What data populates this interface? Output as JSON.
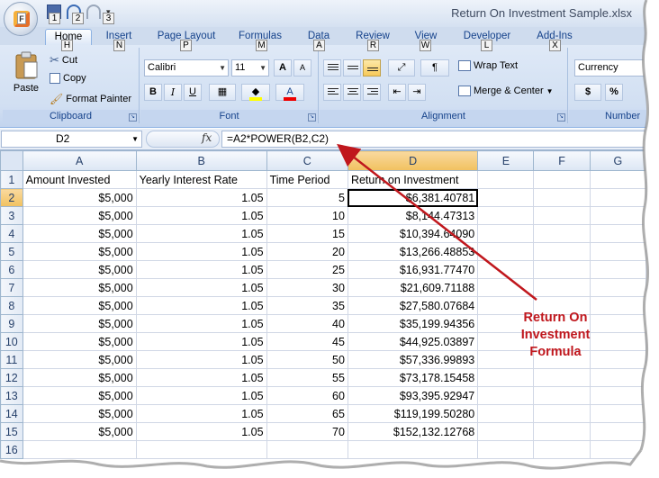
{
  "window": {
    "title": "Return On Investment Sample.xlsx"
  },
  "quick_access": {
    "office_logo": "F",
    "keytips": [
      "1",
      "2",
      "3"
    ]
  },
  "tabs": [
    {
      "label": "Home",
      "keytip": "H",
      "active": true
    },
    {
      "label": "Insert",
      "keytip": "N"
    },
    {
      "label": "Page Layout",
      "keytip": "P"
    },
    {
      "label": "Formulas",
      "keytip": "M"
    },
    {
      "label": "Data",
      "keytip": "A"
    },
    {
      "label": "Review",
      "keytip": "R"
    },
    {
      "label": "View",
      "keytip": "W"
    },
    {
      "label": "Developer",
      "keytip": "L"
    },
    {
      "label": "Add-Ins",
      "keytip": "X"
    }
  ],
  "ribbon": {
    "clipboard": {
      "label": "Clipboard",
      "paste": "Paste",
      "cut": "Cut",
      "copy": "Copy",
      "format_painter": "Format Painter"
    },
    "font": {
      "label": "Font",
      "name": "Calibri",
      "size": "11",
      "bold": "B",
      "italic": "I",
      "underline": "U",
      "grow": "A",
      "shrink": "A"
    },
    "alignment": {
      "label": "Alignment",
      "wrap_text": "Wrap Text",
      "merge_center": "Merge & Center"
    },
    "number": {
      "label": "Number",
      "format": "Currency",
      "currency_symbol": "$",
      "percent": "%"
    }
  },
  "formula_bar": {
    "name_box": "D2",
    "fx": "fx",
    "formula": "=A2*POWER(B2,C2)"
  },
  "sheet": {
    "columns": [
      "A",
      "B",
      "C",
      "D",
      "E",
      "F",
      "G"
    ],
    "selected_column": "D",
    "selected_row": "2",
    "rows": [
      {
        "n": "1",
        "a": "Amount Invested",
        "b": "Yearly Interest Rate",
        "c": "Time Period",
        "d": "Return on Investment"
      },
      {
        "n": "2",
        "a": "$5,000",
        "b": "1.05",
        "c": "5",
        "d": "$6,381.40781"
      },
      {
        "n": "3",
        "a": "$5,000",
        "b": "1.05",
        "c": "10",
        "d": "$8,144.47313"
      },
      {
        "n": "4",
        "a": "$5,000",
        "b": "1.05",
        "c": "15",
        "d": "$10,394.64090"
      },
      {
        "n": "5",
        "a": "$5,000",
        "b": "1.05",
        "c": "20",
        "d": "$13,266.48853"
      },
      {
        "n": "6",
        "a": "$5,000",
        "b": "1.05",
        "c": "25",
        "d": "$16,931.77470"
      },
      {
        "n": "7",
        "a": "$5,000",
        "b": "1.05",
        "c": "30",
        "d": "$21,609.71188"
      },
      {
        "n": "8",
        "a": "$5,000",
        "b": "1.05",
        "c": "35",
        "d": "$27,580.07684"
      },
      {
        "n": "9",
        "a": "$5,000",
        "b": "1.05",
        "c": "40",
        "d": "$35,199.94356"
      },
      {
        "n": "10",
        "a": "$5,000",
        "b": "1.05",
        "c": "45",
        "d": "$44,925.03897"
      },
      {
        "n": "11",
        "a": "$5,000",
        "b": "1.05",
        "c": "50",
        "d": "$57,336.99893"
      },
      {
        "n": "12",
        "a": "$5,000",
        "b": "1.05",
        "c": "55",
        "d": "$73,178.15458"
      },
      {
        "n": "13",
        "a": "$5,000",
        "b": "1.05",
        "c": "60",
        "d": "$93,395.92947"
      },
      {
        "n": "14",
        "a": "$5,000",
        "b": "1.05",
        "c": "65",
        "d": "$119,199.50280"
      },
      {
        "n": "15",
        "a": "$5,000",
        "b": "1.05",
        "c": "70",
        "d": "$152,132.12768"
      },
      {
        "n": "16",
        "a": "",
        "b": "",
        "c": "",
        "d": ""
      }
    ]
  },
  "annotation": {
    "text": [
      "Return On",
      "Investment",
      "Formula"
    ],
    "color": "#c0171d"
  }
}
